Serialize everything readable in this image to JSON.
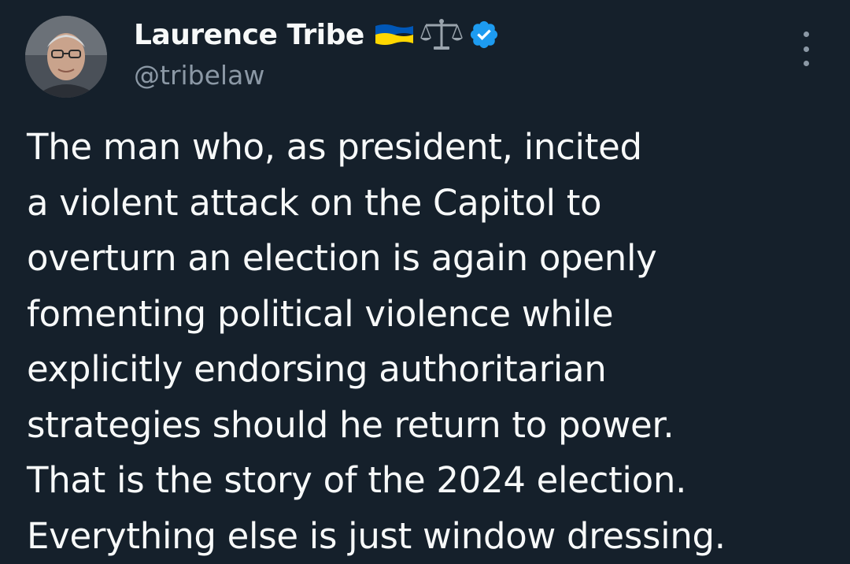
{
  "author": {
    "display_name": "Laurence Tribe",
    "handle": "@tribelaw",
    "badges": [
      "ukraine-flag-icon",
      "balance-scale-icon",
      "verified-badge-icon"
    ]
  },
  "colors": {
    "background": "#15202b",
    "text_primary": "#f7f9f9",
    "text_secondary": "#8b98a5",
    "verified_blue": "#1d9bf0",
    "flag_blue": "#0057b7",
    "flag_yellow": "#ffd700"
  },
  "tweet": {
    "text_lines": [
      "The man who, as president, incited",
      "a violent attack on the Capitol to",
      "overturn an election is again openly",
      "fomenting political violence while",
      "explicitly endorsing authoritarian",
      "strategies should he return to power.",
      "That is the story of the 2024 election.",
      "Everything else is just window dressing."
    ]
  },
  "menu": {
    "icon": "more-vertical-icon"
  }
}
